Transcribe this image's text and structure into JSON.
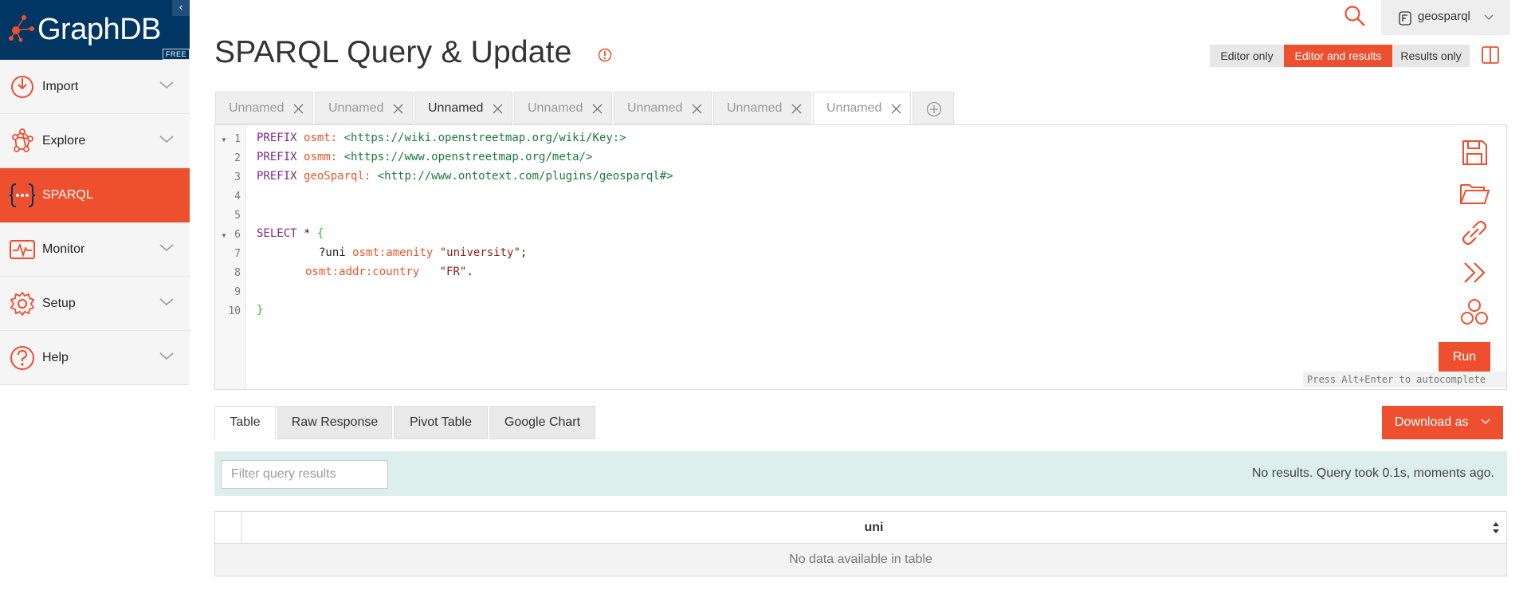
{
  "app": {
    "name": "GraphDB",
    "edition": "FREE",
    "collapse_glyph": "‹"
  },
  "sidebar": {
    "items": [
      {
        "label": "Import",
        "icon": "import-icon",
        "expandable": true
      },
      {
        "label": "Explore",
        "icon": "explore-icon",
        "expandable": true
      },
      {
        "label": "SPARQL",
        "icon": "sparql-icon",
        "expandable": false,
        "active": true
      },
      {
        "label": "Monitor",
        "icon": "monitor-icon",
        "expandable": true
      },
      {
        "label": "Setup",
        "icon": "setup-icon",
        "expandable": true
      },
      {
        "label": "Help",
        "icon": "help-icon",
        "expandable": true
      }
    ]
  },
  "header": {
    "repository": "geosparql",
    "title": "SPARQL Query & Update"
  },
  "view_modes": {
    "editor_only": "Editor only",
    "editor_and_results": "Editor and results",
    "results_only": "Results only",
    "selected": "Editor and results"
  },
  "query_tabs": [
    {
      "label": "Unnamed"
    },
    {
      "label": "Unnamed"
    },
    {
      "label": "Unnamed"
    },
    {
      "label": "Unnamed"
    },
    {
      "label": "Unnamed"
    },
    {
      "label": "Unnamed"
    },
    {
      "label": "Unnamed",
      "active": true
    }
  ],
  "editor": {
    "line_numbers": [
      "1",
      "2",
      "3",
      "4",
      "5",
      "6",
      "7",
      "8",
      "9",
      "10"
    ],
    "lines": {
      "l1_kw": "PREFIX",
      "l1_pfx": "osmt:",
      "l1_iri": "<https://wiki.openstreetmap.org/wiki/Key:>",
      "l2_kw": "PREFIX",
      "l2_pfx": "osmm:",
      "l2_iri": "<https://www.openstreetmap.org/meta/>",
      "l3_kw": "PREFIX",
      "l3_pfx": "geoSparql:",
      "l3_iri": "<http://www.ontotext.com/plugins/geosparql#>",
      "l6_kw": "SELECT",
      "l6_plain": "*",
      "l6_brace": "{",
      "l7_var": "?uni",
      "l7_pfx": "osmt:amenity",
      "l7_str": "\"university\"",
      "l7_end": ";",
      "l8_pfx": "osmt:addr:country",
      "l8_str": "\"FR\"",
      "l8_end": ".",
      "l10_brace": "}"
    },
    "run_label": "Run",
    "autocomplete_hint": "Press Alt+Enter to autocomplete"
  },
  "result_tabs": [
    {
      "label": "Table",
      "active": true
    },
    {
      "label": "Raw Response"
    },
    {
      "label": "Pivot Table"
    },
    {
      "label": "Google Chart"
    }
  ],
  "download_label": "Download as",
  "results": {
    "filter_placeholder": "Filter query results",
    "status": "No results. Query took 0.1s, moments ago.",
    "columns": [
      "uni"
    ],
    "empty_message": "No data available in table"
  },
  "colors": {
    "accent": "#ed4f2f",
    "brand_navy": "#003663",
    "results_bar": "#dcefed"
  }
}
